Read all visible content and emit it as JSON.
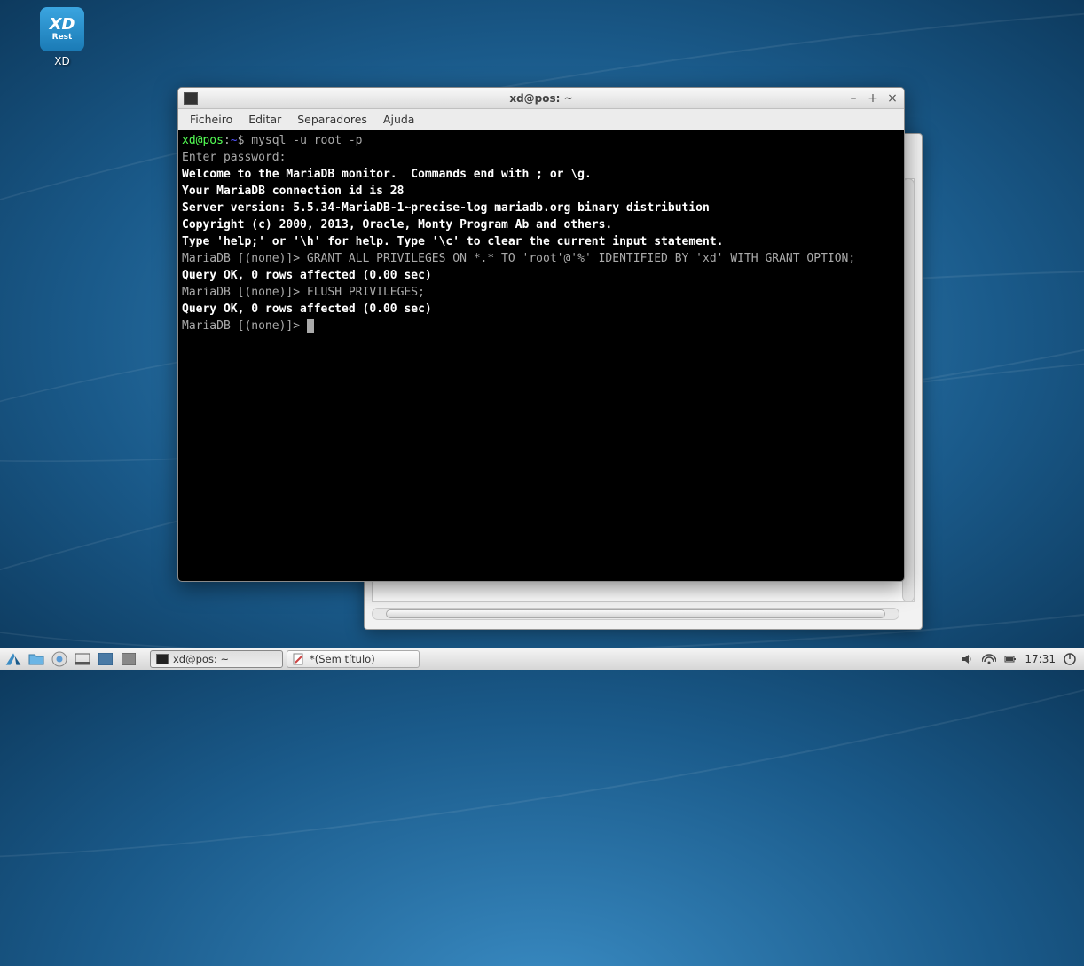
{
  "desktop": {
    "icon_label": "XD",
    "icon_logo_top": "XD",
    "icon_logo_bottom": "Rest"
  },
  "terminal": {
    "title": "xd@pos: ~",
    "menu": {
      "file": "Ficheiro",
      "edit": "Editar",
      "tabs": "Separadores",
      "help": "Ajuda"
    },
    "lines": {
      "l1_prompt_userhost": "xd@pos",
      "l1_prompt_sep": ":",
      "l1_prompt_path": "~",
      "l1_prompt_end": "$ ",
      "l1_cmd": "mysql -u root -p",
      "l2": "Enter password: ",
      "l3": "Welcome to the MariaDB monitor.  Commands end with ; or \\g.",
      "l4": "Your MariaDB connection id is 28",
      "l5": "Server version: 5.5.34-MariaDB-1~precise-log mariadb.org binary distribution",
      "l6": "",
      "l7": "Copyright (c) 2000, 2013, Oracle, Monty Program Ab and others.",
      "l8": "",
      "l9": "Type 'help;' or '\\h' for help. Type '\\c' to clear the current input statement.",
      "l10": "",
      "l11a": "MariaDB [(none)]> ",
      "l11b": "GRANT ALL PRIVILEGES ON *.* TO 'root'@'%' IDENTIFIED BY 'xd' WITH GRANT OPTION;",
      "l12": "Query OK, 0 rows affected (0.00 sec)",
      "l13": "",
      "l14a": "MariaDB [(none)]> ",
      "l14b": "FLUSH PRIVILEGES;",
      "l15": "Query OK, 0 rows affected (0.00 sec)",
      "l16": "",
      "l17a": "MariaDB [(none)]> "
    }
  },
  "taskbar": {
    "task1": "xd@pos: ~",
    "task2": "*(Sem título)",
    "clock": "17:31"
  }
}
